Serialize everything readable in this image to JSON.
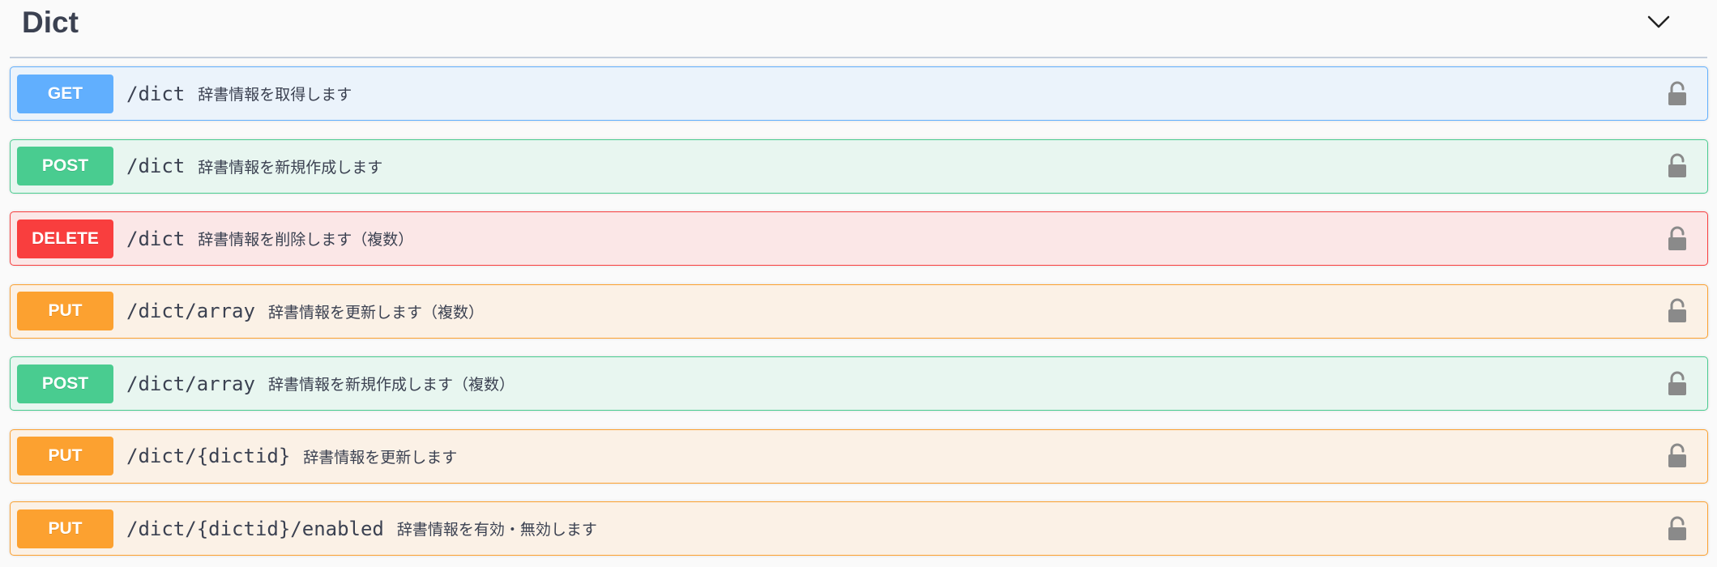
{
  "tag": {
    "title": "Dict",
    "toggle_icon": "chevron-down-icon"
  },
  "operations": [
    {
      "method": "GET",
      "path": "/dict",
      "summary": "辞書情報を取得します"
    },
    {
      "method": "POST",
      "path": "/dict",
      "summary": "辞書情報を新規作成します"
    },
    {
      "method": "DELETE",
      "path": "/dict",
      "summary": "辞書情報を削除します（複数）"
    },
    {
      "method": "PUT",
      "path": "/dict/array",
      "summary": "辞書情報を更新します（複数）"
    },
    {
      "method": "POST",
      "path": "/dict/array",
      "summary": "辞書情報を新規作成します（複数）"
    },
    {
      "method": "PUT",
      "path": "/dict/{dictid}",
      "summary": "辞書情報を更新します"
    },
    {
      "method": "PUT",
      "path": "/dict/{dictid}/enabled",
      "summary": "辞書情報を有効・無効します"
    }
  ],
  "colors": {
    "get": "#61affe",
    "post": "#49cc90",
    "delete": "#f93e3e",
    "put": "#fca130",
    "text": "#3b4151",
    "lock": "#8a8a8a"
  },
  "icons": {
    "lock": "unlocked-padlock-icon"
  }
}
